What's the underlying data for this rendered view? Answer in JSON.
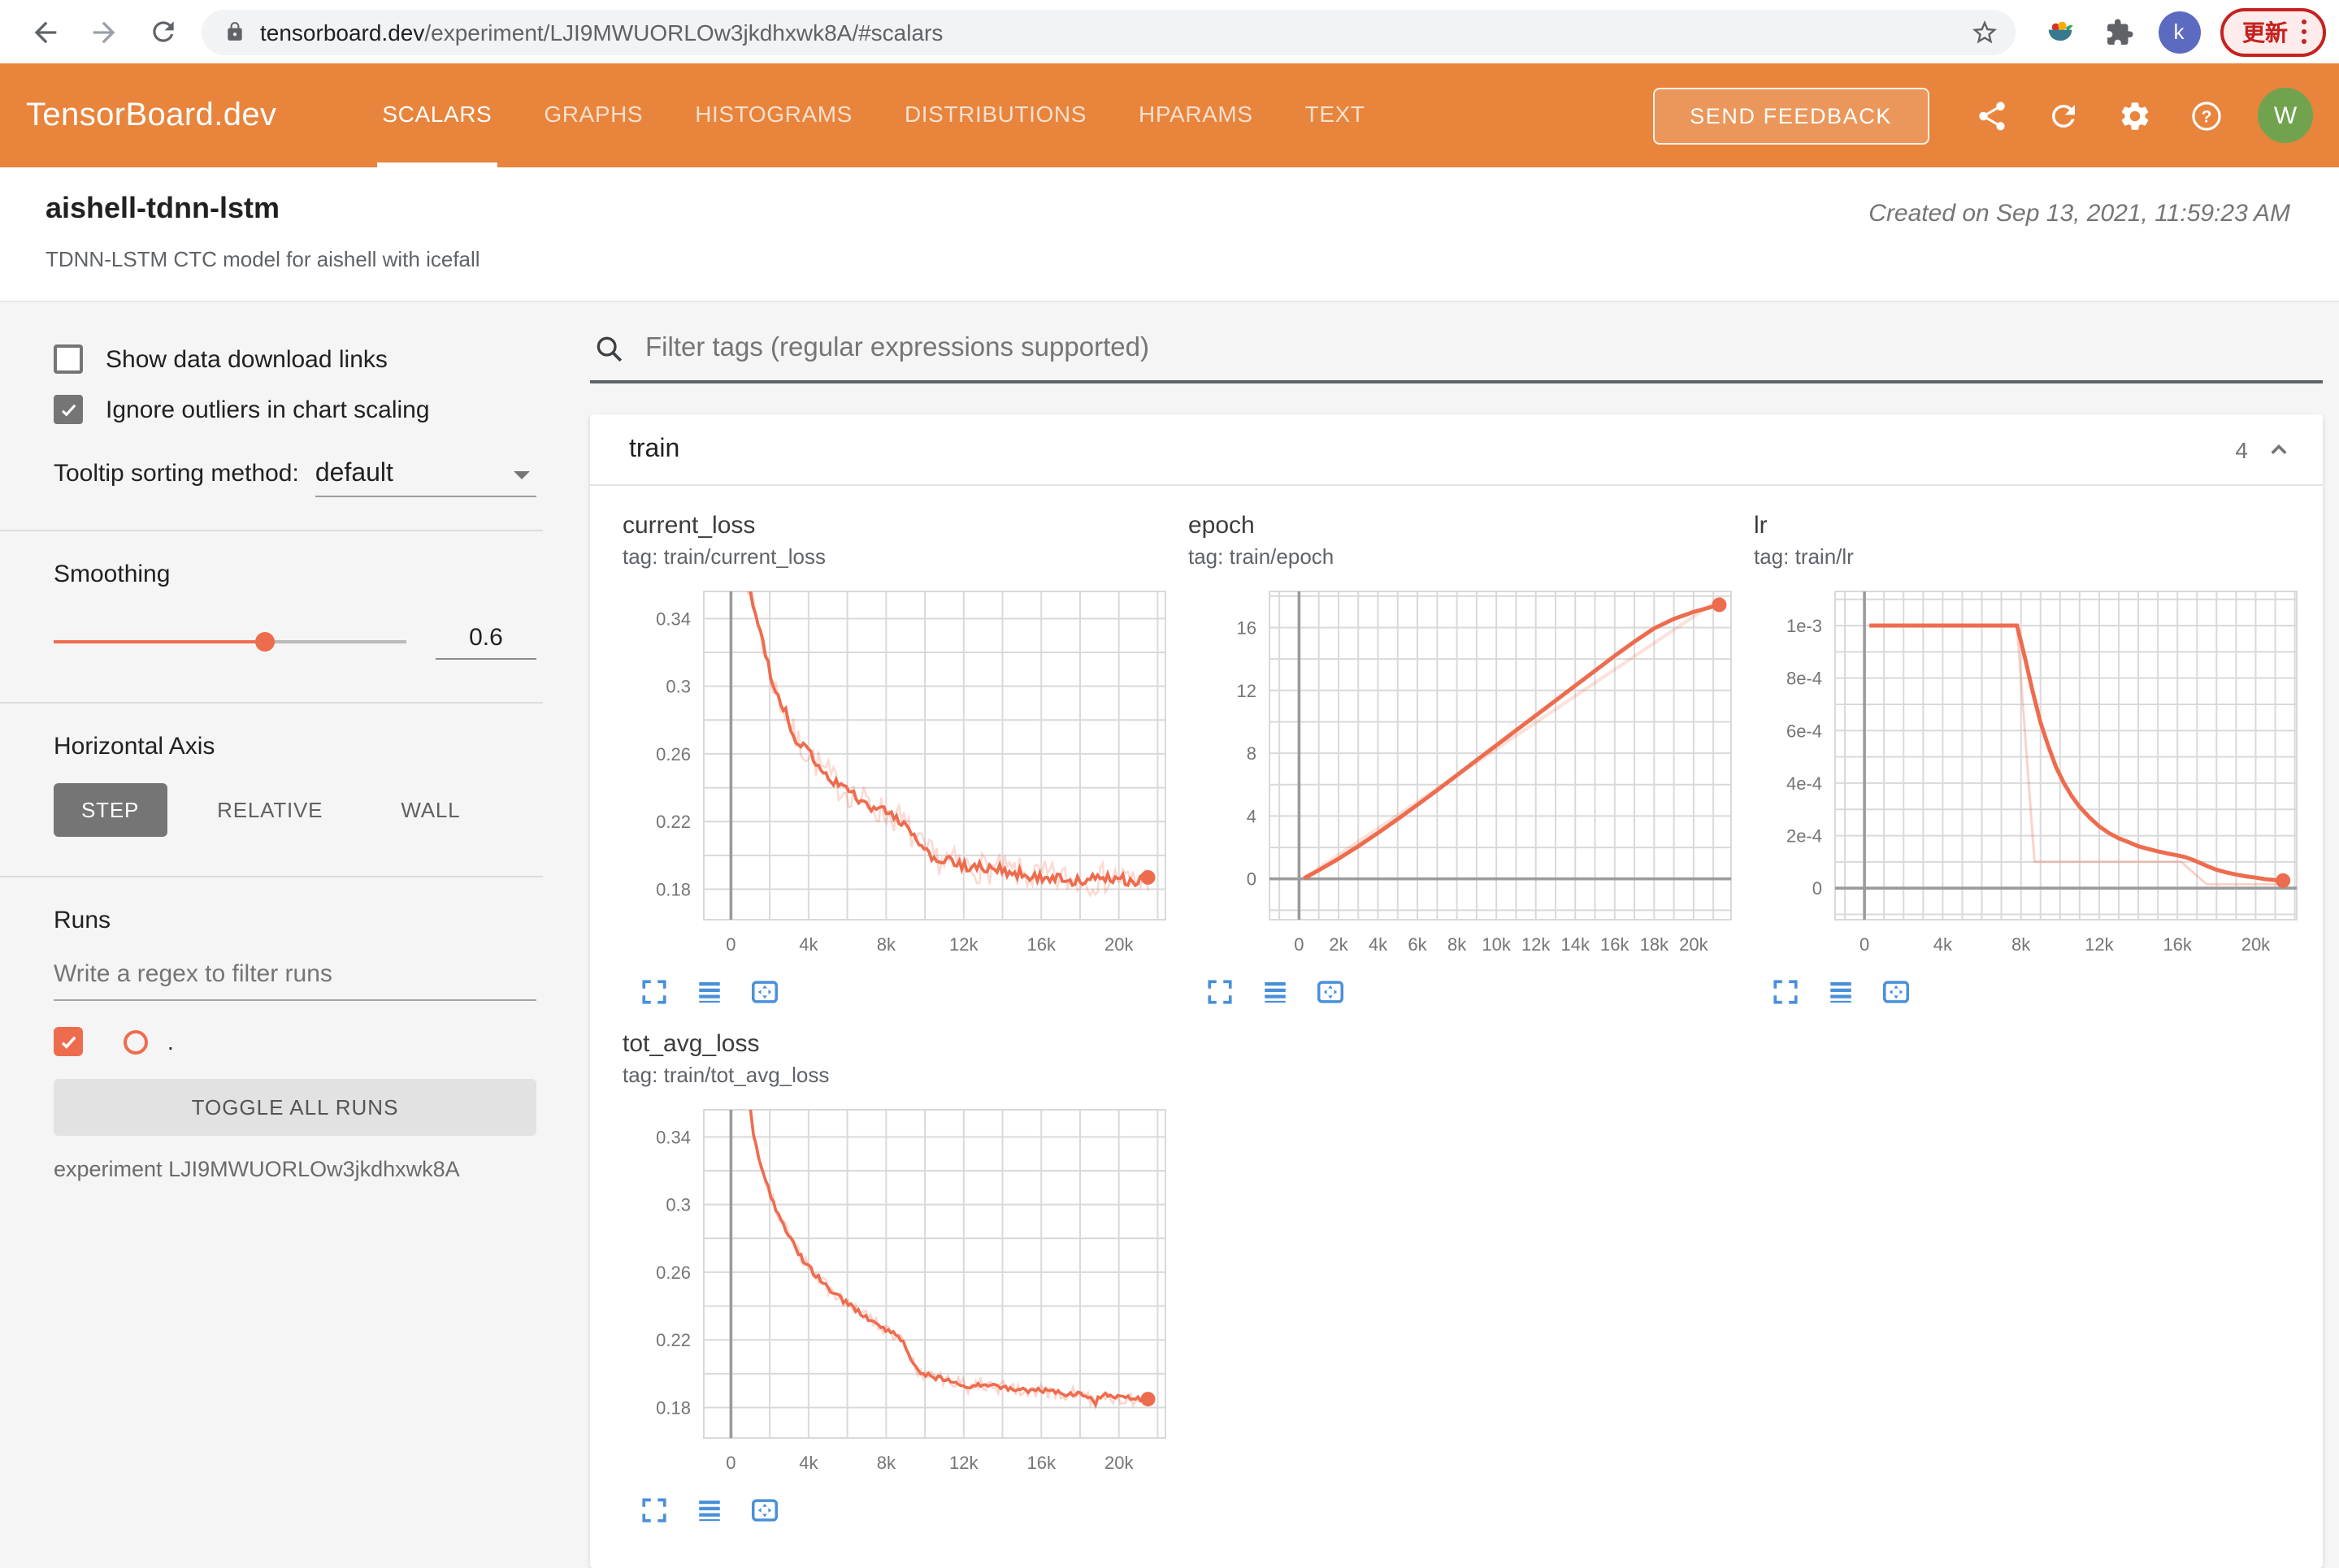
{
  "browser": {
    "url_domain": "tensorboard.dev",
    "url_path": "/experiment/LJI9MWUORLOw3jkdhxwk8A/#scalars",
    "profile_initial": "k",
    "update_label": "更新"
  },
  "header": {
    "logo": "TensorBoard.dev",
    "tabs": [
      {
        "label": "SCALARS"
      },
      {
        "label": "GRAPHS"
      },
      {
        "label": "HISTOGRAMS"
      },
      {
        "label": "DISTRIBUTIONS"
      },
      {
        "label": "HPARAMS"
      },
      {
        "label": "TEXT"
      }
    ],
    "send_feedback": "SEND FEEDBACK",
    "avatar_initial": "W"
  },
  "experiment": {
    "title": "aishell-tdnn-lstm",
    "description": "TDNN-LSTM CTC model for aishell with icefall",
    "created": "Created on Sep 13, 2021, 11:59:23 AM"
  },
  "sidebar": {
    "show_download": {
      "label": "Show data download links",
      "checked": false
    },
    "ignore_outliers": {
      "label": "Ignore outliers in chart scaling",
      "checked": true
    },
    "tooltip_sorting": {
      "label": "Tooltip sorting method:",
      "value": "default"
    },
    "smoothing": {
      "label": "Smoothing",
      "value": "0.6",
      "fraction": 0.6
    },
    "horizontal_axis": {
      "label": "Horizontal Axis",
      "options": [
        "STEP",
        "RELATIVE",
        "WALL"
      ],
      "selected": "STEP"
    },
    "runs": {
      "label": "Runs",
      "placeholder": "Write a regex to filter runs",
      "run_name": ".",
      "run_checked": true,
      "toggle_all": "TOGGLE ALL RUNS",
      "experiment_line": "experiment LJI9MWUORLOw3jkdhxwk8A"
    }
  },
  "main": {
    "filter_placeholder": "Filter tags (regular expressions supported)",
    "group": {
      "name": "train",
      "count": "4"
    }
  },
  "colors": {
    "header_orange": "#e8843c",
    "run_color": "#ee6c4e",
    "tool_icon_blue": "#4a90d9",
    "update_red": "#c5221f",
    "grid_line": "#d9d9d9",
    "axis_line": "#9b9b9b"
  },
  "chart_data": [
    {
      "type": "line",
      "title": "current_loss",
      "tag": "tag: train/current_loss",
      "x": {
        "min": -1400,
        "max": 22400,
        "grid": 2000,
        "zero_line": true,
        "ticks": [
          [
            0,
            "0"
          ],
          [
            4000,
            "4k"
          ],
          [
            8000,
            "8k"
          ],
          [
            12000,
            "12k"
          ],
          [
            16000,
            "16k"
          ],
          [
            20000,
            "20k"
          ]
        ]
      },
      "y": {
        "min": 0.162,
        "max": 0.356,
        "grid": 0.02,
        "zero_line": false,
        "ticks": [
          [
            0.18,
            "0.18"
          ],
          [
            0.22,
            "0.22"
          ],
          [
            0.26,
            "0.26"
          ],
          [
            0.3,
            "0.3"
          ],
          [
            0.34,
            "0.34"
          ]
        ]
      },
      "points": [
        [
          750,
          0.378
        ],
        [
          900,
          0.36
        ],
        [
          1100,
          0.35
        ],
        [
          1400,
          0.338
        ],
        [
          1700,
          0.322
        ],
        [
          2000,
          0.308
        ],
        [
          2300,
          0.298
        ],
        [
          2600,
          0.29
        ],
        [
          2900,
          0.282
        ],
        [
          3200,
          0.272
        ],
        [
          3500,
          0.266
        ],
        [
          3800,
          0.263
        ],
        [
          4100,
          0.259
        ],
        [
          4400,
          0.255
        ],
        [
          4800,
          0.25
        ],
        [
          5200,
          0.245
        ],
        [
          5600,
          0.241
        ],
        [
          6000,
          0.238
        ],
        [
          6400,
          0.2355
        ],
        [
          6800,
          0.2325
        ],
        [
          7200,
          0.2295
        ],
        [
          7600,
          0.227
        ],
        [
          8000,
          0.225
        ],
        [
          8400,
          0.223
        ],
        [
          8800,
          0.2205
        ],
        [
          9200,
          0.214
        ],
        [
          9600,
          0.207
        ],
        [
          10000,
          0.202
        ],
        [
          10400,
          0.199
        ],
        [
          10800,
          0.1975
        ],
        [
          11200,
          0.1965
        ],
        [
          11600,
          0.195
        ],
        [
          12000,
          0.1935
        ],
        [
          12500,
          0.193
        ],
        [
          13000,
          0.1925
        ],
        [
          13500,
          0.192
        ],
        [
          14000,
          0.191
        ],
        [
          14500,
          0.19
        ],
        [
          15000,
          0.189
        ],
        [
          15500,
          0.188
        ],
        [
          16000,
          0.1875
        ],
        [
          16500,
          0.187
        ],
        [
          17000,
          0.186
        ],
        [
          17500,
          0.1855
        ],
        [
          18000,
          0.185
        ],
        [
          18500,
          0.1857
        ],
        [
          19000,
          0.186
        ],
        [
          19500,
          0.1868
        ],
        [
          20000,
          0.1872
        ],
        [
          20500,
          0.1845
        ],
        [
          21000,
          0.185
        ],
        [
          21500,
          0.187
        ]
      ],
      "series": [
        {
          "name": "raw",
          "color": "#ee6c4e",
          "opacity": 0.25,
          "width": 1.3,
          "noise": 0.0095
        },
        {
          "name": "smoothed",
          "color": "#ee6c4e",
          "opacity": 1,
          "width": 1.9,
          "noise": 0.0032
        }
      ],
      "end_dot": [
        21500,
        0.187
      ]
    },
    {
      "type": "line",
      "title": "epoch",
      "tag": "tag: train/epoch",
      "x": {
        "min": -1500,
        "max": 21900,
        "grid": 1000,
        "zero_line": true,
        "ticks": [
          [
            0,
            "0"
          ],
          [
            2000,
            "2k"
          ],
          [
            4000,
            "4k"
          ],
          [
            6000,
            "6k"
          ],
          [
            8000,
            "8k"
          ],
          [
            10000,
            "10k"
          ],
          [
            12000,
            "12k"
          ],
          [
            14000,
            "14k"
          ],
          [
            16000,
            "16k"
          ],
          [
            18000,
            "18k"
          ],
          [
            20000,
            "20k"
          ]
        ]
      },
      "y": {
        "min": -2.6,
        "max": 18.3,
        "grid": 2,
        "zero_line": true,
        "ticks": [
          [
            0,
            "0"
          ],
          [
            4,
            "4"
          ],
          [
            8,
            "8"
          ],
          [
            12,
            "12"
          ],
          [
            16,
            "16"
          ]
        ]
      },
      "series": [
        {
          "name": "raw",
          "color": "#ee6c4e",
          "opacity": 0.2,
          "width": 2.2,
          "noise": 0,
          "points": [
            [
              250,
              0.05
            ],
            [
              21450,
              17.92
            ]
          ]
        },
        {
          "name": "smoothed",
          "color": "#ee6c4e",
          "opacity": 1,
          "width": 2.5,
          "noise": 0,
          "points": [
            [
              250,
              0.03
            ],
            [
              1000,
              0.55
            ],
            [
              2000,
              1.28
            ],
            [
              3000,
              2.08
            ],
            [
              4000,
              2.92
            ],
            [
              5000,
              3.8
            ],
            [
              6000,
              4.72
            ],
            [
              7000,
              5.65
            ],
            [
              8000,
              6.6
            ],
            [
              9000,
              7.55
            ],
            [
              10000,
              8.5
            ],
            [
              11000,
              9.45
            ],
            [
              12000,
              10.4
            ],
            [
              13000,
              11.35
            ],
            [
              14000,
              12.3
            ],
            [
              15000,
              13.25
            ],
            [
              16000,
              14.2
            ],
            [
              17000,
              15.1
            ],
            [
              18000,
              15.95
            ],
            [
              19000,
              16.55
            ],
            [
              20000,
              17.0
            ],
            [
              21300,
              17.45
            ]
          ]
        }
      ],
      "end_dot": [
        21300,
        17.45
      ]
    },
    {
      "type": "line",
      "title": "lr",
      "tag": "tag: train/lr",
      "x": {
        "min": -1500,
        "max": 22100,
        "grid": 1000,
        "zero_line": true,
        "ticks": [
          [
            0,
            "0"
          ],
          [
            4000,
            "4k"
          ],
          [
            8000,
            "8k"
          ],
          [
            12000,
            "12k"
          ],
          [
            16000,
            "16k"
          ],
          [
            20000,
            "20k"
          ]
        ]
      },
      "y": {
        "min": -0.00012,
        "max": 0.00113,
        "grid": 0.0001,
        "zero_line": true,
        "ticks": [
          [
            0.001,
            "1e-3"
          ],
          [
            0.0008,
            "8e-4"
          ],
          [
            0.0006,
            "6e-4"
          ],
          [
            0.0004,
            "4e-4"
          ],
          [
            0.0002,
            "2e-4"
          ],
          [
            0,
            "0"
          ]
        ]
      },
      "series": [
        {
          "name": "raw",
          "color": "#ee6c4e",
          "opacity": 0.3,
          "width": 1.5,
          "noise": 0,
          "points": [
            [
              250,
              0.001
            ],
            [
              7800,
              0.001
            ],
            [
              8700,
              0.0001
            ],
            [
              16200,
              0.0001
            ],
            [
              16500,
              8e-05
            ],
            [
              17500,
              1.5e-05
            ],
            [
              21400,
              1.5e-05
            ]
          ]
        },
        {
          "name": "smoothed",
          "color": "#ee6c4e",
          "opacity": 1,
          "width": 2.5,
          "noise": 0,
          "points": [
            [
              250,
              0.001
            ],
            [
              7800,
              0.001
            ],
            [
              8200,
              0.00088
            ],
            [
              8600,
              0.00075
            ],
            [
              9000,
              0.00063
            ],
            [
              9400,
              0.00054
            ],
            [
              9800,
              0.00046
            ],
            [
              10200,
              0.0004
            ],
            [
              10600,
              0.00035
            ],
            [
              11000,
              0.00031
            ],
            [
              11500,
              0.00027
            ],
            [
              12000,
              0.000235
            ],
            [
              12500,
              0.00021
            ],
            [
              13000,
              0.00019
            ],
            [
              13500,
              0.000175
            ],
            [
              14000,
              0.00016
            ],
            [
              14500,
              0.00015
            ],
            [
              15000,
              0.00014
            ],
            [
              15500,
              0.000132
            ],
            [
              16000,
              0.000125
            ],
            [
              16400,
              0.000118
            ],
            [
              16800,
              0.000108
            ],
            [
              17200,
              9.5e-05
            ],
            [
              17600,
              8.2e-05
            ],
            [
              18000,
              7e-05
            ],
            [
              18500,
              6e-05
            ],
            [
              19000,
              5.2e-05
            ],
            [
              19500,
              4.5e-05
            ],
            [
              20000,
              4e-05
            ],
            [
              20500,
              3.4e-05
            ],
            [
              21000,
              3.1e-05
            ],
            [
              21400,
              2.9e-05
            ]
          ]
        }
      ],
      "end_dot": [
        21400,
        2.9e-05
      ]
    },
    {
      "type": "line",
      "title": "tot_avg_loss",
      "tag": "tag: train/tot_avg_loss",
      "x": {
        "min": -1400,
        "max": 22400,
        "grid": 2000,
        "zero_line": true,
        "ticks": [
          [
            0,
            "0"
          ],
          [
            4000,
            "4k"
          ],
          [
            8000,
            "8k"
          ],
          [
            12000,
            "12k"
          ],
          [
            16000,
            "16k"
          ],
          [
            20000,
            "20k"
          ]
        ]
      },
      "y": {
        "min": 0.162,
        "max": 0.356,
        "grid": 0.02,
        "zero_line": false,
        "ticks": [
          [
            0.18,
            "0.18"
          ],
          [
            0.22,
            "0.22"
          ],
          [
            0.26,
            "0.26"
          ],
          [
            0.3,
            "0.3"
          ],
          [
            0.34,
            "0.34"
          ]
        ]
      },
      "points": [
        [
          900,
          0.368
        ],
        [
          1100,
          0.345
        ],
        [
          1300,
          0.334
        ],
        [
          1500,
          0.326
        ],
        [
          1700,
          0.318
        ],
        [
          2000,
          0.307
        ],
        [
          2300,
          0.298
        ],
        [
          2600,
          0.291
        ],
        [
          2900,
          0.284
        ],
        [
          3200,
          0.277
        ],
        [
          3500,
          0.271
        ],
        [
          3800,
          0.266
        ],
        [
          4100,
          0.262
        ],
        [
          4400,
          0.258
        ],
        [
          4700,
          0.254
        ],
        [
          5000,
          0.251
        ],
        [
          5400,
          0.247
        ],
        [
          5800,
          0.243
        ],
        [
          6200,
          0.24
        ],
        [
          6600,
          0.236
        ],
        [
          7000,
          0.233
        ],
        [
          7400,
          0.23
        ],
        [
          7800,
          0.228
        ],
        [
          8200,
          0.225
        ],
        [
          8600,
          0.222
        ],
        [
          8900,
          0.22
        ],
        [
          9100,
          0.213
        ],
        [
          9400,
          0.206
        ],
        [
          9700,
          0.202
        ],
        [
          10000,
          0.2
        ],
        [
          10400,
          0.198
        ],
        [
          10800,
          0.197
        ],
        [
          11200,
          0.196
        ],
        [
          11600,
          0.195
        ],
        [
          12000,
          0.193
        ],
        [
          12200,
          0.19
        ],
        [
          12400,
          0.194
        ],
        [
          12800,
          0.194
        ],
        [
          13200,
          0.193
        ],
        [
          13600,
          0.193
        ],
        [
          14000,
          0.192
        ],
        [
          14500,
          0.191
        ],
        [
          15000,
          0.191
        ],
        [
          15500,
          0.19
        ],
        [
          16000,
          0.19
        ],
        [
          16500,
          0.189
        ],
        [
          17000,
          0.189
        ],
        [
          17500,
          0.188
        ],
        [
          18000,
          0.188
        ],
        [
          18400,
          0.187
        ],
        [
          18800,
          0.182
        ],
        [
          19000,
          0.187
        ],
        [
          19500,
          0.187
        ],
        [
          20000,
          0.186
        ],
        [
          20500,
          0.186
        ],
        [
          21000,
          0.185
        ],
        [
          21500,
          0.185
        ]
      ],
      "series": [
        {
          "name": "raw",
          "color": "#ee6c4e",
          "opacity": 0.28,
          "width": 1.3,
          "noise": 0.0042
        },
        {
          "name": "smoothed",
          "color": "#ee6c4e",
          "opacity": 1,
          "width": 1.8,
          "noise": 0.0016
        }
      ],
      "end_dot": [
        21500,
        0.185
      ]
    }
  ]
}
